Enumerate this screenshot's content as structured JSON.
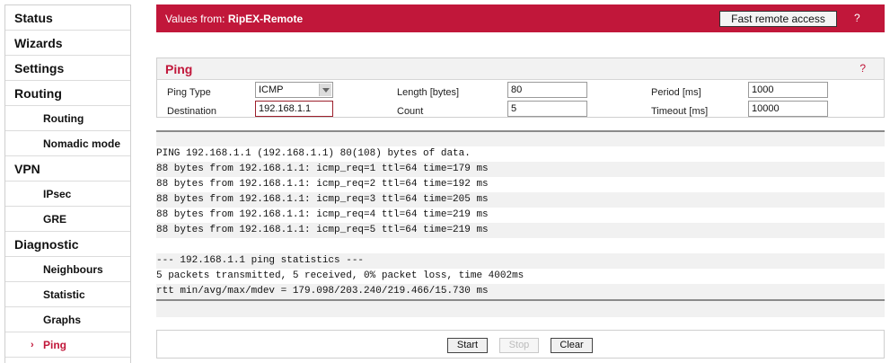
{
  "sidebar": {
    "items": [
      {
        "label": "Status",
        "level": "top"
      },
      {
        "label": "Wizards",
        "level": "top"
      },
      {
        "label": "Settings",
        "level": "top"
      },
      {
        "label": "Routing",
        "level": "top"
      },
      {
        "label": "Routing",
        "level": "sub"
      },
      {
        "label": "Nomadic mode",
        "level": "sub"
      },
      {
        "label": "VPN",
        "level": "top"
      },
      {
        "label": "IPsec",
        "level": "sub"
      },
      {
        "label": "GRE",
        "level": "sub"
      },
      {
        "label": "Diagnostic",
        "level": "top"
      },
      {
        "label": "Neighbours",
        "level": "sub"
      },
      {
        "label": "Statistic",
        "level": "sub"
      },
      {
        "label": "Graphs",
        "level": "sub"
      },
      {
        "label": "Ping",
        "level": "sub",
        "active": true
      }
    ],
    "active_marker": "›"
  },
  "header": {
    "prefix": "Values from: ",
    "device": "RipEX-Remote",
    "fast_remote_label": "Fast remote access",
    "help": "?"
  },
  "ping": {
    "title": "Ping",
    "help": "?",
    "ping_type_label": "Ping Type",
    "ping_type_value": "ICMP",
    "destination_label": "Destination",
    "destination_value": "192.168.1.1",
    "length_label": "Length [bytes]",
    "length_value": "80",
    "count_label": "Count",
    "count_value": "5",
    "period_label": "Period [ms]",
    "period_value": "1000",
    "timeout_label": "Timeout [ms]",
    "timeout_value": "10000"
  },
  "output": {
    "lines": [
      "PING 192.168.1.1 (192.168.1.1) 80(108) bytes of data.",
      "88 bytes from 192.168.1.1: icmp_req=1 ttl=64 time=179 ms",
      "88 bytes from 192.168.1.1: icmp_req=2 ttl=64 time=192 ms",
      "88 bytes from 192.168.1.1: icmp_req=3 ttl=64 time=205 ms",
      "88 bytes from 192.168.1.1: icmp_req=4 ttl=64 time=219 ms",
      "88 bytes from 192.168.1.1: icmp_req=5 ttl=64 time=219 ms",
      "",
      "--- 192.168.1.1 ping statistics ---",
      "5 packets transmitted, 5 received, 0% packet loss, time 4002ms",
      "rtt min/avg/max/mdev = 179.098/203.240/219.466/15.730 ms"
    ]
  },
  "controls": {
    "start_label": "Start",
    "stop_label": "Stop",
    "clear_label": "Clear"
  },
  "colors": {
    "accent": "#c1173a"
  }
}
